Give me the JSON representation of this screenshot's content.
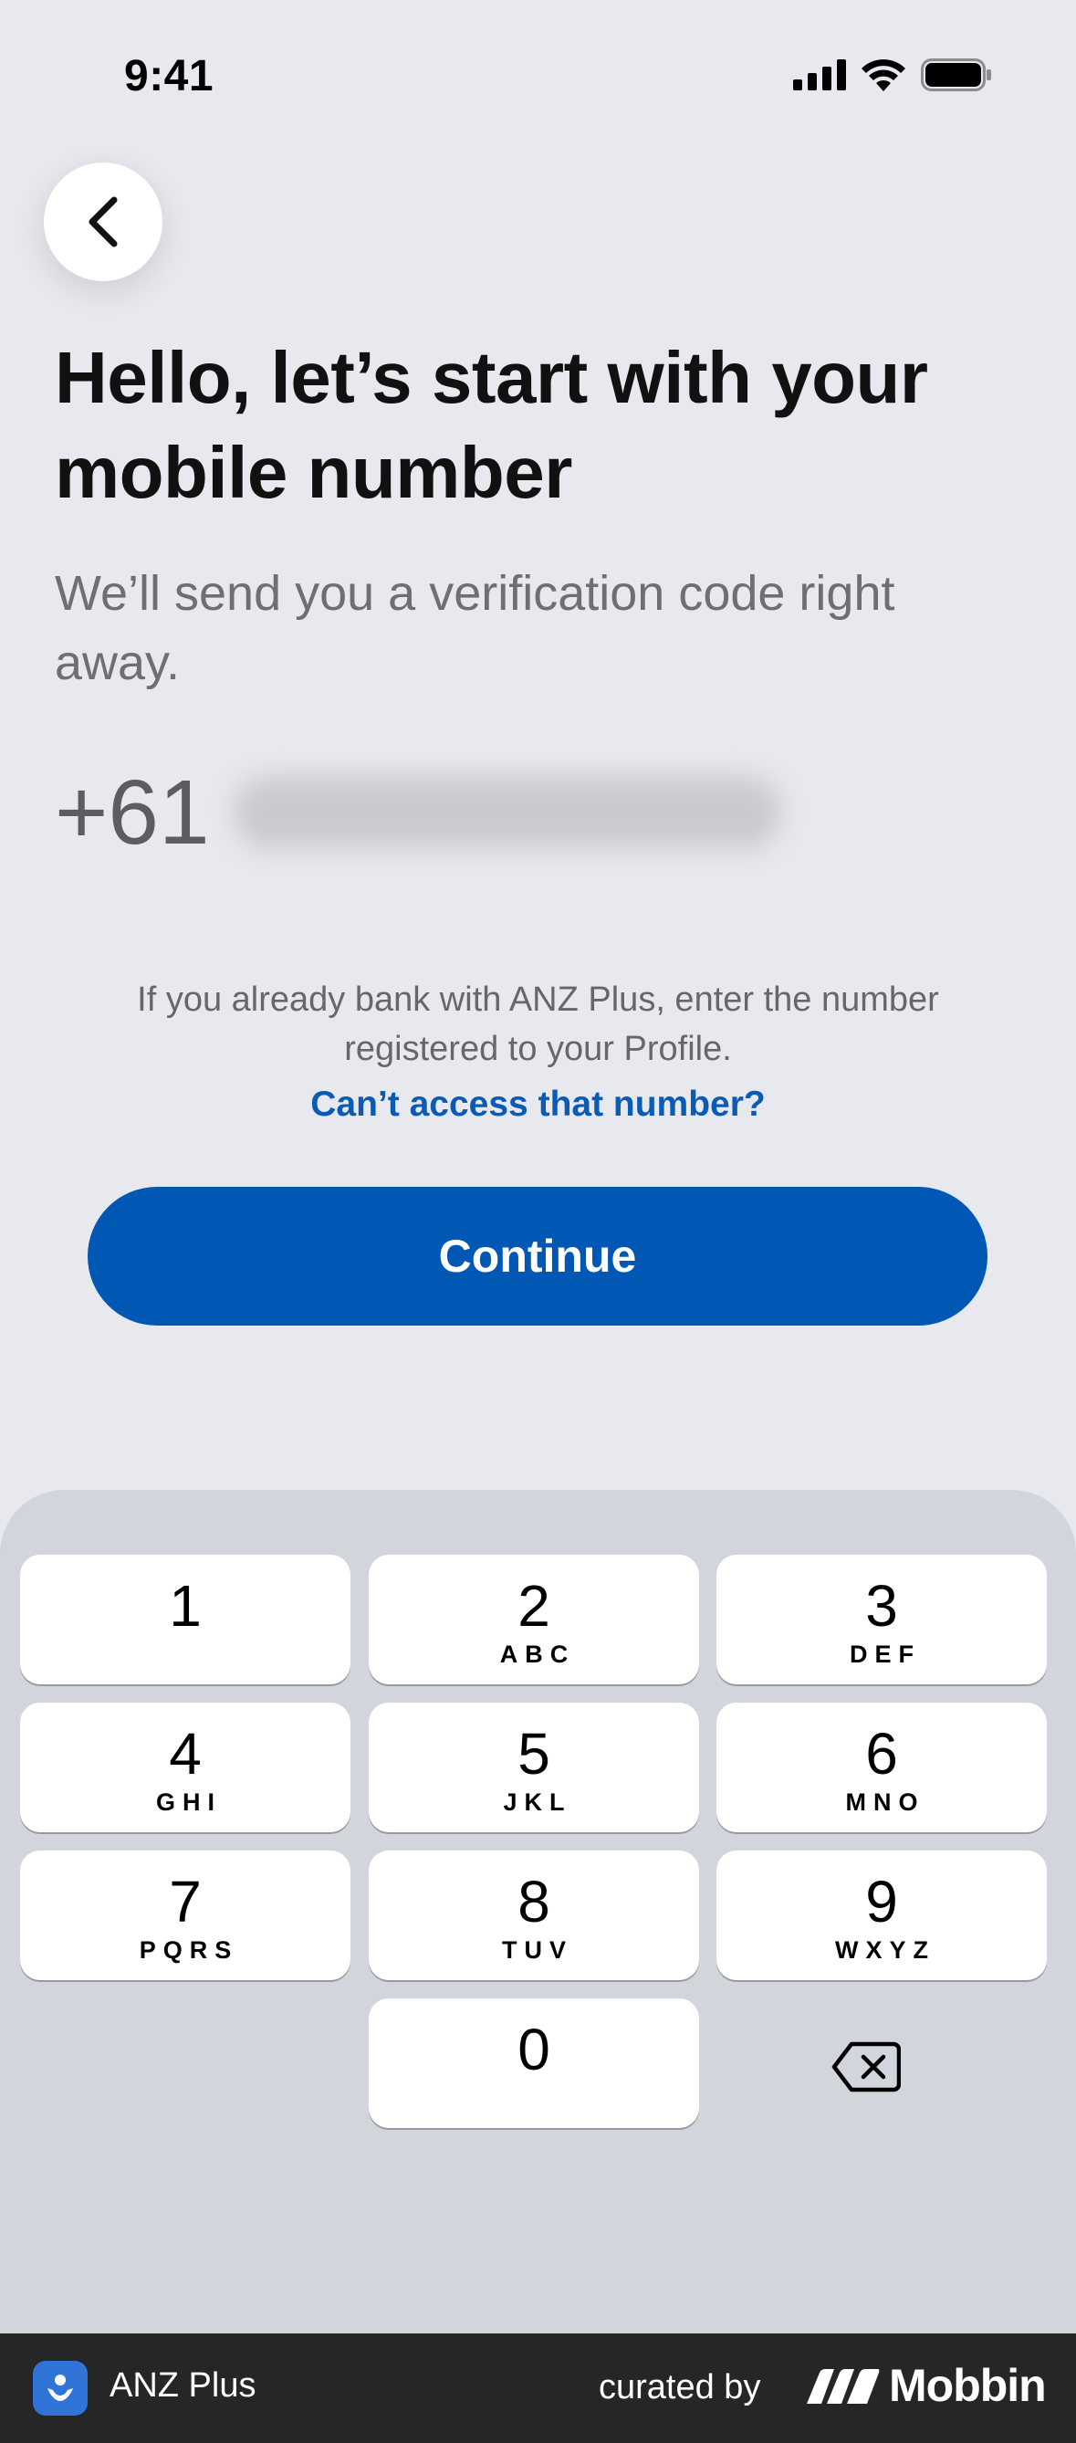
{
  "status_bar": {
    "time": "9:41"
  },
  "header": {
    "back_icon": "chevron-left-icon",
    "title": "Hello, let’s start with your mobile number",
    "subtitle": "We’ll send you a verification code right away."
  },
  "phone": {
    "country_code": "+61",
    "number_obscured": ""
  },
  "info": {
    "text": "If you already bank with ANZ Plus, enter the number registered to your Profile.",
    "link": "Can’t access that number?"
  },
  "continue_label": "Continue",
  "keypad": {
    "keys": [
      {
        "digit": "1",
        "letters": ""
      },
      {
        "digit": "2",
        "letters": "ABC"
      },
      {
        "digit": "3",
        "letters": "DEF"
      },
      {
        "digit": "4",
        "letters": "GHI"
      },
      {
        "digit": "5",
        "letters": "JKL"
      },
      {
        "digit": "6",
        "letters": "MNO"
      },
      {
        "digit": "7",
        "letters": "PQRS"
      },
      {
        "digit": "8",
        "letters": "TUV"
      },
      {
        "digit": "9",
        "letters": "WXYZ"
      },
      {
        "digit": "0",
        "letters": ""
      }
    ],
    "delete_icon": "backspace-icon"
  },
  "footer": {
    "app_name": "ANZ Plus",
    "curated_by": "curated by",
    "brand": "Mobbin"
  },
  "colors": {
    "background": "#e8e9ee",
    "primary": "#0157b4",
    "link": "#0b5bb5",
    "keypad_bg": "#d3d5dc",
    "footer_bg": "#262626"
  }
}
